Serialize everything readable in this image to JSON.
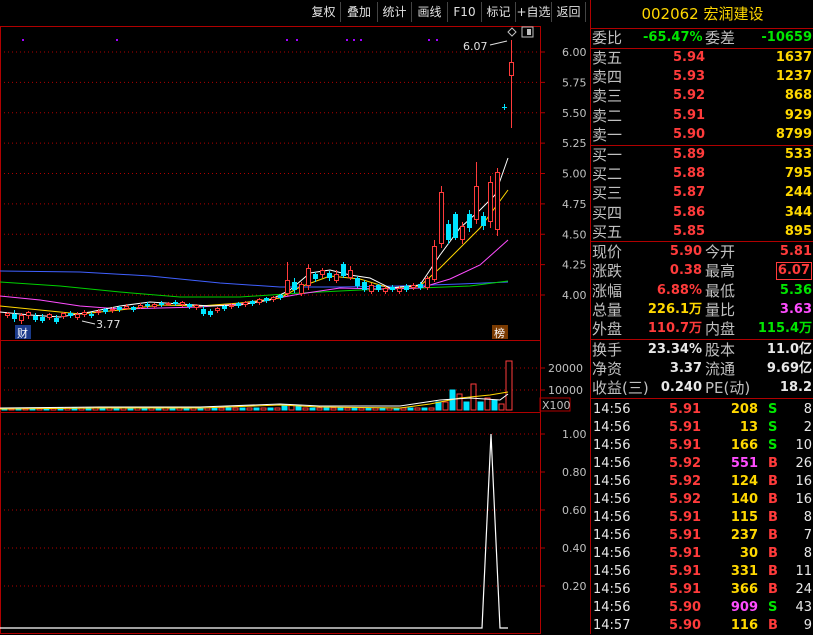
{
  "toolbar": {
    "buttons": [
      "复权",
      "叠加",
      "统计",
      "画线",
      "F10",
      "标记",
      "+自选",
      "返回"
    ]
  },
  "kline": {
    "y_ticks": [
      "6.00",
      "5.75",
      "5.50",
      "5.25",
      "5.00",
      "4.75",
      "4.50",
      "4.25",
      "4.00"
    ],
    "high_label": "6.07",
    "low_label": "3.77",
    "cai_badge": "财",
    "bang_badge": "榜"
  },
  "volume": {
    "y_ticks": [
      "20000",
      "10000"
    ],
    "unit": "X100"
  },
  "indicator": {
    "y_ticks": [
      "1.00",
      "0.80",
      "0.60",
      "0.40",
      "0.20"
    ]
  },
  "quote": {
    "code": "002062",
    "name": "宏润建设",
    "weibi_label": "委比",
    "weibi_value": "-65.47%",
    "weicha_label": "委差",
    "weicha_value": "-10659",
    "asks": [
      {
        "label": "卖五",
        "price": "5.94",
        "vol": "1637"
      },
      {
        "label": "卖四",
        "price": "5.93",
        "vol": "1237"
      },
      {
        "label": "卖三",
        "price": "5.92",
        "vol": "868"
      },
      {
        "label": "卖二",
        "price": "5.91",
        "vol": "929"
      },
      {
        "label": "卖一",
        "price": "5.90",
        "vol": "8799"
      }
    ],
    "bids": [
      {
        "label": "买一",
        "price": "5.89",
        "vol": "533"
      },
      {
        "label": "买二",
        "price": "5.88",
        "vol": "795"
      },
      {
        "label": "买三",
        "price": "5.87",
        "vol": "244"
      },
      {
        "label": "买四",
        "price": "5.86",
        "vol": "344"
      },
      {
        "label": "买五",
        "price": "5.85",
        "vol": "895"
      }
    ],
    "stats1": [
      {
        "l1": "现价",
        "v1": "5.90",
        "l2": "今开",
        "v2": "5.81"
      },
      {
        "l1": "涨跌",
        "v1": "0.38",
        "l2": "最高",
        "v2": "6.07"
      },
      {
        "l1": "涨幅",
        "v1": "6.88%",
        "l2": "最低",
        "v2": "5.36"
      },
      {
        "l1": "总量",
        "v1": "226.1万",
        "l2": "量比",
        "v2": "3.63"
      },
      {
        "l1": "外盘",
        "v1": "110.7万",
        "l2": "内盘",
        "v2": "115.4万"
      }
    ],
    "stats2": [
      {
        "l1": "换手",
        "v1": "23.34%",
        "l2": "股本",
        "v2": "11.0亿"
      },
      {
        "l1": "净资",
        "v1": "3.37",
        "l2": "流通",
        "v2": "9.69亿"
      },
      {
        "l1": "收益(三)",
        "v1": "0.240",
        "l2": "PE(动)",
        "v2": "18.2"
      }
    ],
    "ticks": [
      {
        "time": "14:56",
        "price": "5.91",
        "vol": "208",
        "side": "S",
        "count": "8"
      },
      {
        "time": "14:56",
        "price": "5.91",
        "vol": "13",
        "side": "S",
        "count": "2"
      },
      {
        "time": "14:56",
        "price": "5.91",
        "vol": "166",
        "side": "S",
        "count": "10"
      },
      {
        "time": "14:56",
        "price": "5.92",
        "vol": "551",
        "side": "B",
        "count": "26"
      },
      {
        "time": "14:56",
        "price": "5.92",
        "vol": "124",
        "side": "B",
        "count": "16"
      },
      {
        "time": "14:56",
        "price": "5.92",
        "vol": "140",
        "side": "B",
        "count": "16"
      },
      {
        "time": "14:56",
        "price": "5.91",
        "vol": "115",
        "side": "B",
        "count": "8"
      },
      {
        "time": "14:56",
        "price": "5.91",
        "vol": "237",
        "side": "B",
        "count": "7"
      },
      {
        "time": "14:56",
        "price": "5.91",
        "vol": "30",
        "side": "B",
        "count": "8"
      },
      {
        "time": "14:56",
        "price": "5.91",
        "vol": "331",
        "side": "B",
        "count": "11"
      },
      {
        "time": "14:56",
        "price": "5.91",
        "vol": "366",
        "side": "B",
        "count": "24"
      },
      {
        "time": "14:56",
        "price": "5.90",
        "vol": "909",
        "side": "S",
        "count": "43"
      },
      {
        "time": "14:57",
        "price": "5.90",
        "vol": "116",
        "side": "B",
        "count": "9"
      }
    ]
  },
  "colors": {
    "up": "#ff3b3b",
    "down": "#00e5ff",
    "grid": "#b00000",
    "ma5": "#ffffff",
    "ma10": "#ffd800",
    "ma20": "#ff4dff",
    "ma60": "#00d000",
    "ma120": "#4060ff"
  }
}
